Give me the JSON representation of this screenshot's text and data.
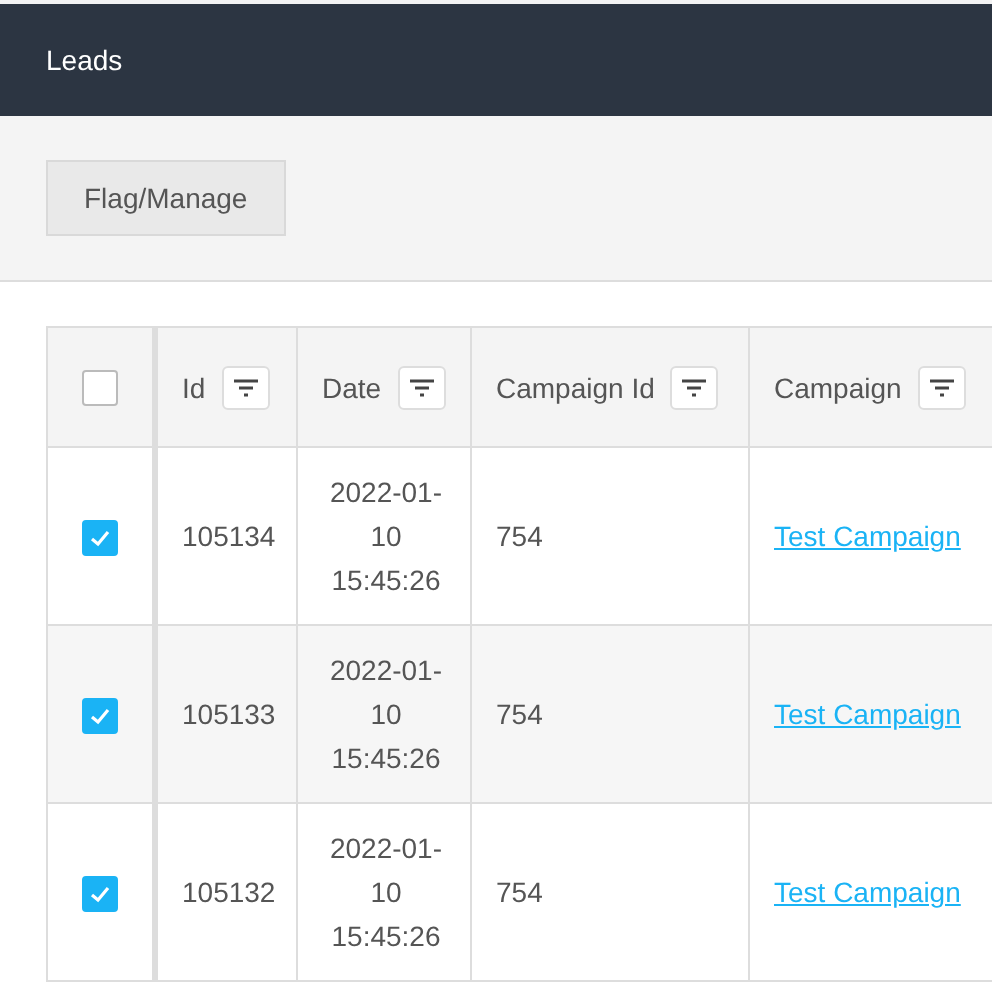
{
  "header": {
    "title": "Leads"
  },
  "toolbar": {
    "buttons": [
      "Flag/Manage"
    ]
  },
  "table": {
    "select_all": {
      "checked": false
    },
    "columns": [
      "Id",
      "Date",
      "Campaign Id",
      "Campaign"
    ],
    "rows": [
      {
        "checked": true,
        "id": "105134",
        "date": "2022-01-10 15:45:26",
        "campaign_id": "754",
        "campaign": "Test Campaign"
      },
      {
        "checked": true,
        "id": "105133",
        "date": "2022-01-10 15:45:26",
        "campaign_id": "754",
        "campaign": "Test Campaign"
      },
      {
        "checked": true,
        "id": "105132",
        "date": "2022-01-10 15:45:26",
        "campaign_id": "754",
        "campaign": "Test Campaign"
      }
    ]
  }
}
